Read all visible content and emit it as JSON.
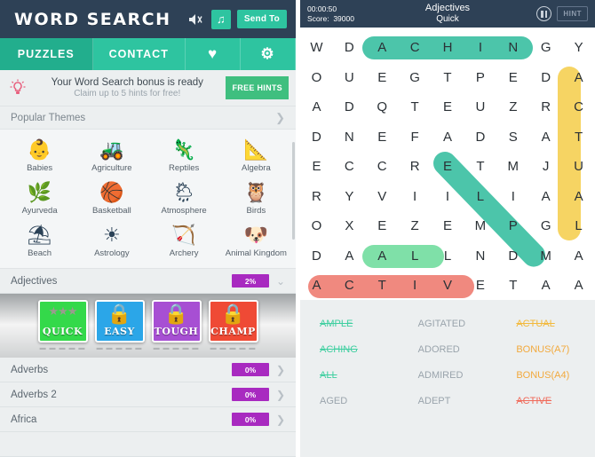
{
  "left": {
    "logo": "WORD SEARCH",
    "header_icons": [
      {
        "name": "speaker-mute-icon",
        "glyph": "🔇"
      },
      {
        "name": "music-note-icon",
        "glyph": "♫"
      }
    ],
    "send_to_label": "Send To",
    "tabs": [
      {
        "label": "PUZZLES",
        "name": "tab-puzzles",
        "active": true
      },
      {
        "label": "CONTACT",
        "name": "tab-contact",
        "active": false
      },
      {
        "label": "♥",
        "name": "tab-favorites",
        "active": false
      },
      {
        "label": "⚙",
        "name": "tab-settings",
        "active": false
      }
    ],
    "banner": {
      "icon": "lightbulb-icon",
      "title": "Your Word Search bonus is ready",
      "subtitle": "Claim up to 5 hints for free!",
      "button": "FREE HINTS"
    },
    "popular_themes_label": "Popular Themes",
    "themes": [
      {
        "label": "Babies",
        "glyph": "👶"
      },
      {
        "label": "Agriculture",
        "glyph": "🚜"
      },
      {
        "label": "Reptiles",
        "glyph": "🦎"
      },
      {
        "label": "Algebra",
        "glyph": "📐"
      },
      {
        "label": "Ayurveda",
        "glyph": "🌿"
      },
      {
        "label": "Basketball",
        "glyph": "🏀"
      },
      {
        "label": "Atmosphere",
        "glyph": "🌦"
      },
      {
        "label": "Birds",
        "glyph": "🦉"
      },
      {
        "label": "Beach",
        "glyph": "⛱"
      },
      {
        "label": "Astrology",
        "glyph": "☀"
      },
      {
        "label": "Archery",
        "glyph": "🏹"
      },
      {
        "label": "Animal Kingdom",
        "glyph": "🐶"
      }
    ],
    "puzzle_rows": [
      {
        "name": "Adjectives",
        "percent": "2%",
        "expanded": true
      },
      {
        "name": "Adverbs",
        "percent": "0%",
        "expanded": false
      },
      {
        "name": "Adverbs 2",
        "percent": "0%",
        "expanded": false
      },
      {
        "name": "Africa",
        "percent": "0%",
        "expanded": false
      }
    ],
    "difficulty_cards": [
      {
        "label": "QUICK",
        "color": "#34d94a",
        "locked": false,
        "stars": "★★★",
        "dots": "▬ ▬ ▬ ▬ ▬"
      },
      {
        "label": "EASY",
        "color": "#2ba6e8",
        "locked": true,
        "stars": "",
        "dots": "▬ ▬ ▬ ▬ ▬"
      },
      {
        "label": "TOUGH",
        "color": "#a74fd3",
        "locked": true,
        "stars": "",
        "dots": "▬ ▬ ▬ ▬ ▬"
      },
      {
        "label": "CHAMP",
        "color": "#ef4a35",
        "locked": true,
        "stars": "",
        "dots": "▬ ▬ ▬ ▬ ▬"
      }
    ]
  },
  "right": {
    "timer": "00:00:50",
    "score_label": "Score:",
    "score_value": "39000",
    "title": "Adjectives",
    "subtitle": "Quick",
    "hint_label": "HINT",
    "grid": [
      [
        "W",
        "D",
        "A",
        "C",
        "H",
        "I",
        "N",
        "G",
        "Y"
      ],
      [
        "O",
        "U",
        "E",
        "G",
        "T",
        "P",
        "E",
        "D",
        "A"
      ],
      [
        "A",
        "D",
        "Q",
        "T",
        "E",
        "U",
        "Z",
        "R",
        "C"
      ],
      [
        "D",
        "N",
        "E",
        "F",
        "A",
        "D",
        "S",
        "A",
        "T"
      ],
      [
        "E",
        "C",
        "C",
        "R",
        "E",
        "T",
        "M",
        "J",
        "U"
      ],
      [
        "R",
        "Y",
        "V",
        "I",
        "I",
        "L",
        "I",
        "A",
        "A"
      ],
      [
        "O",
        "X",
        "E",
        "Z",
        "E",
        "M",
        "P",
        "G",
        "L"
      ],
      [
        "D",
        "A",
        "A",
        "L",
        "L",
        "N",
        "D",
        "M",
        "A"
      ],
      [
        "A",
        "C",
        "T",
        "I",
        "V",
        "E",
        "T",
        "A",
        "A"
      ]
    ],
    "highlights": [
      {
        "word": "ACHING",
        "color": "#4cc5aa",
        "orientation": "horizontal"
      },
      {
        "word": "ACTUAL",
        "color": "#f6d463",
        "orientation": "vertical"
      },
      {
        "word": "AMPLE",
        "color": "#4cc5aa",
        "orientation": "diagonal"
      },
      {
        "word": "ALL",
        "color": "#7fe0a8",
        "orientation": "horizontal"
      },
      {
        "word": "ACTIVE",
        "color": "#f0897f",
        "orientation": "horizontal"
      }
    ],
    "word_rows": [
      [
        {
          "text": "AMPLE",
          "state": "found-g"
        },
        {
          "text": "AGITATED",
          "state": ""
        },
        {
          "text": "ACTUAL",
          "state": "found-y"
        }
      ],
      [
        {
          "text": "ACHING",
          "state": "found-g"
        },
        {
          "text": "ADORED",
          "state": ""
        },
        {
          "text": "BONUS(A7)",
          "state": "bonus"
        }
      ],
      [
        {
          "text": "ALL",
          "state": "found-g"
        },
        {
          "text": "ADMIRED",
          "state": ""
        },
        {
          "text": "BONUS(A4)",
          "state": "bonus"
        }
      ],
      [
        {
          "text": "AGED",
          "state": ""
        },
        {
          "text": "ADEPT",
          "state": ""
        },
        {
          "text": "ACTIVE",
          "state": "found-r"
        }
      ]
    ]
  }
}
